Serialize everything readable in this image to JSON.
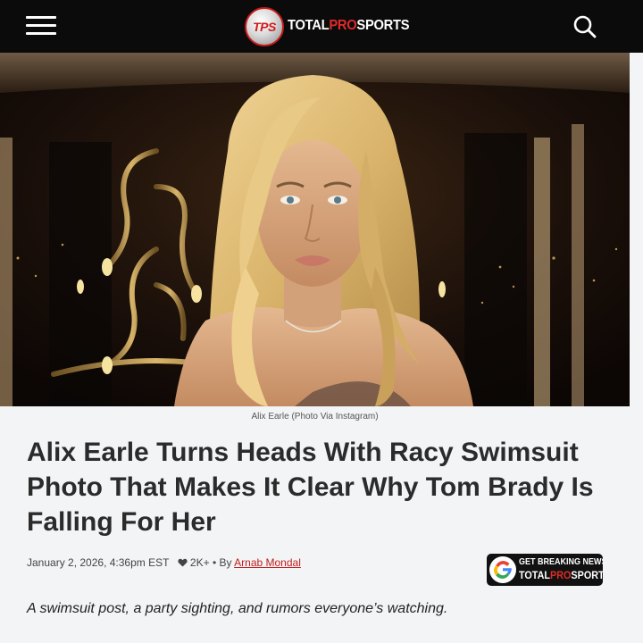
{
  "header": {
    "menu_icon": "hamburger-menu-icon",
    "logo": {
      "badge": "TPS",
      "word_prefix": "TOTAL",
      "word_accent": "PRO",
      "word_suffix": "SPORTS"
    },
    "search_icon": "search-icon"
  },
  "hero": {
    "caption": "Alix Earle (Photo Via Instagram)"
  },
  "article": {
    "headline": "Alix Earle Turns Heads With Racy Swimsuit Photo That Makes It Clear Why Tom Brady Is Falling For Her",
    "date": "January 2, 2026, 4:36pm EST",
    "likes": "2K+",
    "by_label": "• By",
    "author": "Arnab Mondal",
    "dek": "A swimsuit post, a party sighting, and rumors everyone’s watching."
  },
  "google_news_badge": {
    "line1": "GET BREAKING NEWS",
    "line2_prefix": "TOTAL",
    "line2_accent": "PRO",
    "line2_suffix": "SPORTS"
  },
  "colors": {
    "header_bg": "#0b0b0b",
    "accent_red": "#c21d1d",
    "page_bg": "#f3f4f6"
  }
}
